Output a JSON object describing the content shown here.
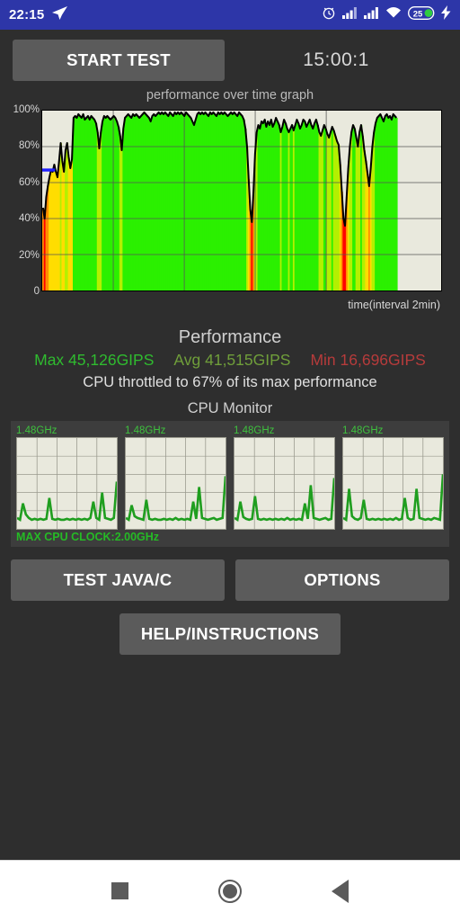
{
  "status_bar": {
    "time": "22:15",
    "icons": [
      "telegram-send-icon",
      "alarm-clock-icon",
      "signal-bars-1-icon",
      "signal-bars-2-icon",
      "wifi-icon",
      "battery-icon",
      "charging-bolt-icon"
    ],
    "battery_level": "25",
    "background_color": "#2d36a8"
  },
  "toolbar": {
    "start_test_label": "START TEST",
    "timer": "15:00:1"
  },
  "graph": {
    "title": "performance over time graph",
    "xlabel": "time(interval 2min)",
    "ylabels": [
      "100%",
      "80%",
      "60%",
      "40%",
      "20%",
      "0"
    ]
  },
  "performance": {
    "heading": "Performance",
    "max_label": "Max 45,126GIPS",
    "avg_label": "Avg 41,515GIPS",
    "min_label": "Min 16,696GIPS",
    "max_color": "#2fbb2f",
    "avg_color": "#6f9e3a",
    "min_color": "#b63b3b",
    "note": "CPU throttled to 67% of its max performance"
  },
  "cpu_monitor": {
    "title": "CPU Monitor",
    "cores": [
      {
        "label": "1.48GHz"
      },
      {
        "label": "1.48GHz"
      },
      {
        "label": "1.48GHz"
      },
      {
        "label": "1.48GHz"
      }
    ],
    "max_clock": "MAX CPU CLOCK:2.00GHz",
    "accent_color": "#25bb25"
  },
  "buttons": {
    "test_java_c": "TEST JAVA/C",
    "options": "OPTIONS",
    "help_instructions": "HELP/INSTRUCTIONS"
  },
  "navigation": {
    "recents": "recents-square-icon",
    "home": "home-circle-icon",
    "back": "back-triangle-icon"
  },
  "chart_data": {
    "type": "area",
    "title": "performance over time graph",
    "xlabel": "time(interval 2min)",
    "ylabel": "",
    "ylim": [
      0,
      100
    ],
    "ytick_labels": [
      "0",
      "20%",
      "40%",
      "60%",
      "80%",
      "100%"
    ],
    "yticks": [
      0,
      20,
      40,
      60,
      80,
      100
    ],
    "grid": true,
    "threshold_line": {
      "value": 67,
      "color": "#2020ff",
      "x_start": 0,
      "x_end": 7
    },
    "series": [
      {
        "name": "performance %",
        "values": [
          46,
          40,
          52,
          58,
          63,
          67,
          66,
          70,
          66,
          63,
          72,
          82,
          72,
          66,
          78,
          82,
          74,
          68,
          73,
          96,
          97,
          96,
          98,
          97,
          96,
          98,
          95,
          96,
          97,
          95,
          97,
          96,
          95,
          93,
          88,
          79,
          88,
          94,
          97,
          96,
          97,
          96,
          95,
          96,
          97,
          96,
          94,
          91,
          86,
          78,
          90,
          96,
          97,
          98,
          97,
          96,
          98,
          97,
          98,
          97,
          96,
          97,
          98,
          99,
          98,
          97,
          96,
          94,
          97,
          98,
          97,
          98,
          99,
          98,
          99,
          98,
          99,
          98,
          97,
          99,
          98,
          97,
          99,
          98,
          99,
          98,
          99,
          98,
          97,
          99,
          98,
          97,
          96,
          94,
          92,
          95,
          98,
          99,
          98,
          99,
          98,
          99,
          98,
          97,
          99,
          98,
          99,
          98,
          97,
          99,
          98,
          99,
          98,
          99,
          98,
          97,
          98,
          99,
          98,
          99,
          98,
          97,
          99,
          98,
          97,
          95,
          90,
          80,
          62,
          45,
          38,
          55,
          76,
          88,
          92,
          90,
          94,
          93,
          95,
          91,
          94,
          92,
          95,
          91,
          93,
          96,
          94,
          92,
          88,
          91,
          95,
          93,
          90,
          88,
          90,
          92,
          89,
          92,
          95,
          93,
          90,
          92,
          95,
          94,
          91,
          93,
          95,
          92,
          90,
          93,
          95,
          92,
          88,
          86,
          89,
          92,
          90,
          87,
          85,
          88,
          91,
          89,
          86,
          83,
          81,
          70,
          55,
          40,
          36,
          52,
          68,
          80,
          88,
          92,
          90,
          85,
          80,
          88,
          92,
          86,
          78,
          72,
          65,
          58,
          68,
          80,
          88,
          93,
          96,
          97,
          98,
          96,
          94,
          97,
          98,
          96,
          97,
          95,
          98,
          97,
          96
        ]
      }
    ],
    "bar_colors_note": "Bars colored by value: red <45, orange 45-60, yellow 60-75, yellow-green 75-90, green >90",
    "color_scale": [
      {
        "max": 45,
        "color": "#ff0000"
      },
      {
        "max": 60,
        "color": "#ff9000"
      },
      {
        "max": 75,
        "color": "#ffdd00"
      },
      {
        "max": 90,
        "color": "#b4f000"
      },
      {
        "max": 101,
        "color": "#2bf000"
      }
    ]
  },
  "cpu_chart_data": {
    "type": "line",
    "series": [
      {
        "name": "core0",
        "values": [
          12,
          10,
          28,
          16,
          12,
          10,
          11,
          10,
          11,
          10,
          11,
          34,
          11,
          10,
          11,
          10,
          10,
          11,
          10,
          11,
          10,
          11,
          10,
          11,
          10,
          12,
          30,
          12,
          10,
          40,
          12,
          11,
          10,
          12,
          52
        ]
      },
      {
        "name": "core1",
        "values": [
          12,
          10,
          26,
          14,
          12,
          11,
          10,
          32,
          11,
          10,
          11,
          10,
          10,
          11,
          10,
          11,
          10,
          12,
          10,
          11,
          10,
          11,
          10,
          30,
          11,
          46,
          12,
          11,
          10,
          11,
          12,
          10,
          11,
          12,
          58
        ]
      },
      {
        "name": "core2",
        "values": [
          12,
          10,
          30,
          13,
          11,
          10,
          11,
          36,
          11,
          10,
          11,
          10,
          11,
          10,
          11,
          10,
          11,
          10,
          12,
          10,
          11,
          10,
          11,
          10,
          28,
          11,
          48,
          12,
          11,
          10,
          11,
          12,
          10,
          11,
          56
        ]
      },
      {
        "name": "core3",
        "values": [
          12,
          10,
          44,
          14,
          11,
          10,
          12,
          32,
          11,
          10,
          11,
          10,
          11,
          10,
          11,
          10,
          11,
          10,
          12,
          10,
          11,
          34,
          12,
          10,
          11,
          44,
          12,
          11,
          10,
          11,
          10,
          12,
          11,
          10,
          60
        ]
      }
    ],
    "line_color": "#1f9e1f",
    "background": "#e9e9dd",
    "grid": true
  }
}
